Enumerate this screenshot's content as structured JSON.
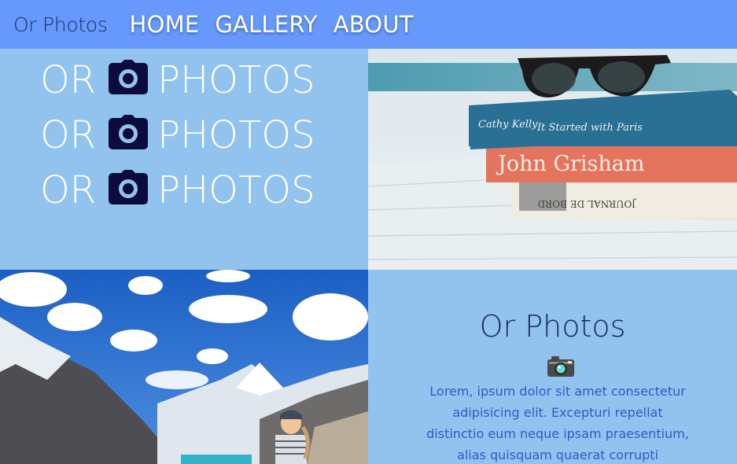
{
  "nav": {
    "brand": "Or Photos",
    "links": [
      "HOME",
      "GALLERY",
      "ABOUT"
    ]
  },
  "hero": {
    "lines": [
      {
        "left": "OR",
        "icon": "camera-icon",
        "right": "PHOTOS"
      },
      {
        "left": "OR",
        "icon": "camera-icon",
        "right": "PHOTOS"
      },
      {
        "left": "OR",
        "icon": "camera-icon",
        "right": "PHOTOS"
      }
    ]
  },
  "images": {
    "books": {
      "book1": "Cathy Kelly",
      "book1b": "It Started with Paris",
      "book2": "John Grisham",
      "book3": "JOURNAL DE BORD"
    },
    "mountain": "mountain-lake-photo"
  },
  "about": {
    "title": "Or Photos",
    "icon": "camera-emoji-icon",
    "text": "Lorem, ipsum dolor sit amet consectetur adipisicing elit. Excepturi repellat distinctio eum neque ipsam praesentium, alias quisquam quaerat corrupti molestiae quis"
  },
  "colors": {
    "navbar": "#6699fb",
    "panel": "#91c3ee",
    "brand_text": "#1d2d6a",
    "body_text": "#3b55c4",
    "camera_dark": "#0c0b3d"
  }
}
